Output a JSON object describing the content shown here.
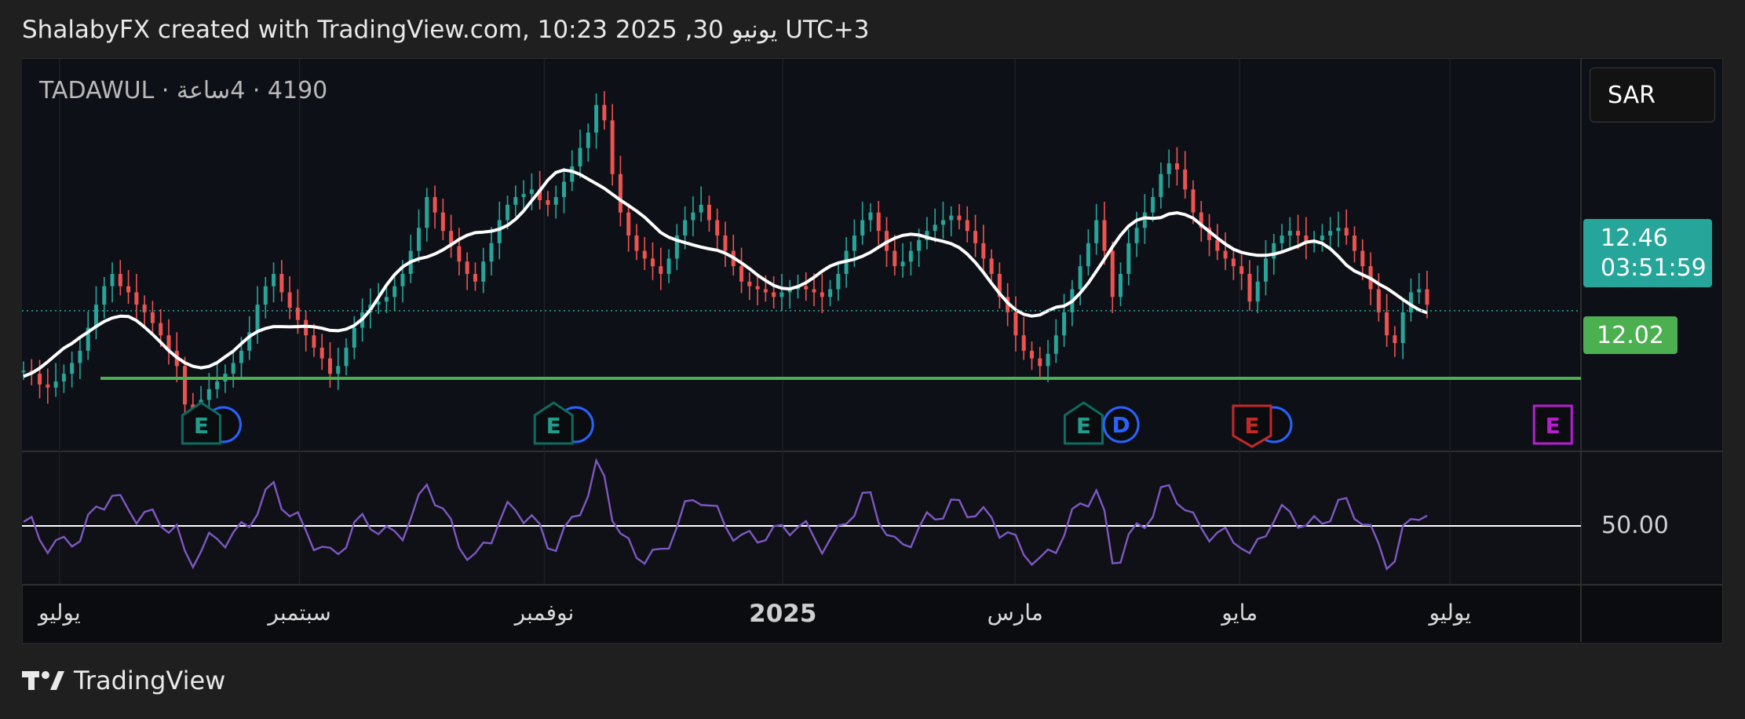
{
  "header": {
    "title": "ShalabyFX created with TradingView.com, 10:23 2025 ,30 يونيو UTC+3"
  },
  "symbol": {
    "label": "4190 · 4ساعة · TADAWUL"
  },
  "currency": {
    "label": "SAR"
  },
  "price": {
    "last": "12.46",
    "countdown": "03:51:59",
    "support": "12.02"
  },
  "rsi": {
    "level_label": "50.00"
  },
  "footer": {
    "brand": "TradingView"
  },
  "colors": {
    "up": "#26a69a",
    "down": "#ef5350",
    "ma": "#ffffff",
    "support": "#4caf50",
    "rsi": "#7e57c2",
    "earnings": "#0d6b5f",
    "dividend": "#2962ff",
    "earnings_bad": "#c62828",
    "earnings_future": "#b81ed0"
  },
  "events": [
    {
      "icon": "earnings-icon",
      "letter": "E",
      "kind": "earnings",
      "month_pos": 0.115,
      "with_dividend": true
    },
    {
      "icon": "earnings-icon",
      "letter": "E",
      "kind": "earnings",
      "month_pos": 0.341,
      "with_dividend": true
    },
    {
      "icon": "earnings-icon",
      "letter": "E",
      "kind": "earnings",
      "month_pos": 0.681,
      "with_dividend": false
    },
    {
      "icon": "dividend-icon",
      "letter": "D",
      "kind": "dividend",
      "month_pos": 0.705,
      "with_dividend": false
    },
    {
      "icon": "earnings-icon",
      "letter": "E",
      "kind": "earnings_bad",
      "month_pos": 0.789,
      "with_dividend": true
    },
    {
      "icon": "earnings-icon",
      "letter": "E",
      "kind": "earnings_future",
      "month_pos": 0.982,
      "with_dividend": false
    }
  ],
  "chart_data": {
    "type": "candlestick",
    "price_range": [
      11.55,
      14.1
    ],
    "last_price": 12.46,
    "support_level": 12.02,
    "x_labels": [
      {
        "text": "يوليو",
        "pos": 0.014,
        "bold": false
      },
      {
        "text": "سبتمبر",
        "pos": 0.168,
        "bold": false
      },
      {
        "text": "نوفمبر",
        "pos": 0.325,
        "bold": false
      },
      {
        "text": "2025",
        "pos": 0.478,
        "bold": true
      },
      {
        "text": "مارس",
        "pos": 0.627,
        "bold": false
      },
      {
        "text": "مايو",
        "pos": 0.771,
        "bold": false
      },
      {
        "text": "يوليو",
        "pos": 0.906,
        "bold": false
      }
    ],
    "close_series": [
      12.07,
      12.05,
      11.98,
      11.96,
      12.0,
      12.05,
      12.12,
      12.2,
      12.35,
      12.5,
      12.62,
      12.7,
      12.62,
      12.58,
      12.5,
      12.45,
      12.38,
      12.3,
      12.2,
      12.1,
      11.85,
      11.8,
      11.88,
      11.95,
      12.0,
      12.05,
      12.12,
      12.2,
      12.32,
      12.5,
      12.62,
      12.7,
      12.58,
      12.48,
      12.4,
      12.3,
      12.22,
      12.15,
      12.05,
      12.1,
      12.22,
      12.35,
      12.45,
      12.5,
      12.52,
      12.55,
      12.62,
      12.7,
      12.85,
      13.0,
      13.2,
      13.1,
      12.98,
      12.88,
      12.78,
      12.7,
      12.65,
      12.78,
      12.9,
      13.05,
      13.15,
      13.2,
      13.22,
      13.25,
      13.18,
      13.15,
      13.2,
      13.3,
      13.4,
      13.52,
      13.62,
      13.8,
      13.7,
      13.35,
      13.1,
      12.95,
      12.85,
      12.8,
      12.75,
      12.7,
      12.8,
      12.95,
      13.05,
      13.1,
      13.15,
      13.05,
      12.95,
      12.85,
      12.75,
      12.65,
      12.62,
      12.6,
      12.58,
      12.55,
      12.58,
      12.6,
      12.62,
      12.6,
      12.58,
      12.55,
      12.6,
      12.7,
      12.85,
      12.95,
      13.05,
      13.1,
      12.98,
      12.85,
      12.75,
      12.78,
      12.85,
      12.92,
      12.98,
      13.02,
      13.05,
      13.08,
      13.05,
      12.98,
      12.9,
      12.8,
      12.7,
      12.55,
      12.45,
      12.3,
      12.2,
      12.15,
      12.1,
      12.18,
      12.3,
      12.45,
      12.6,
      12.75,
      12.9,
      13.05,
      12.85,
      12.55,
      12.7,
      12.9,
      13.0,
      13.1,
      13.2,
      13.35,
      13.42,
      13.38,
      13.25,
      13.1,
      13.0,
      12.92,
      12.85,
      12.8,
      12.75,
      12.7,
      12.52,
      12.65,
      12.8,
      12.9,
      12.95,
      12.98,
      12.95,
      12.9,
      12.92,
      12.95,
      12.98,
      13.0,
      12.95,
      12.85,
      12.75,
      12.6,
      12.45,
      12.3,
      12.25,
      12.45,
      12.58,
      12.6,
      12.5
    ]
  }
}
